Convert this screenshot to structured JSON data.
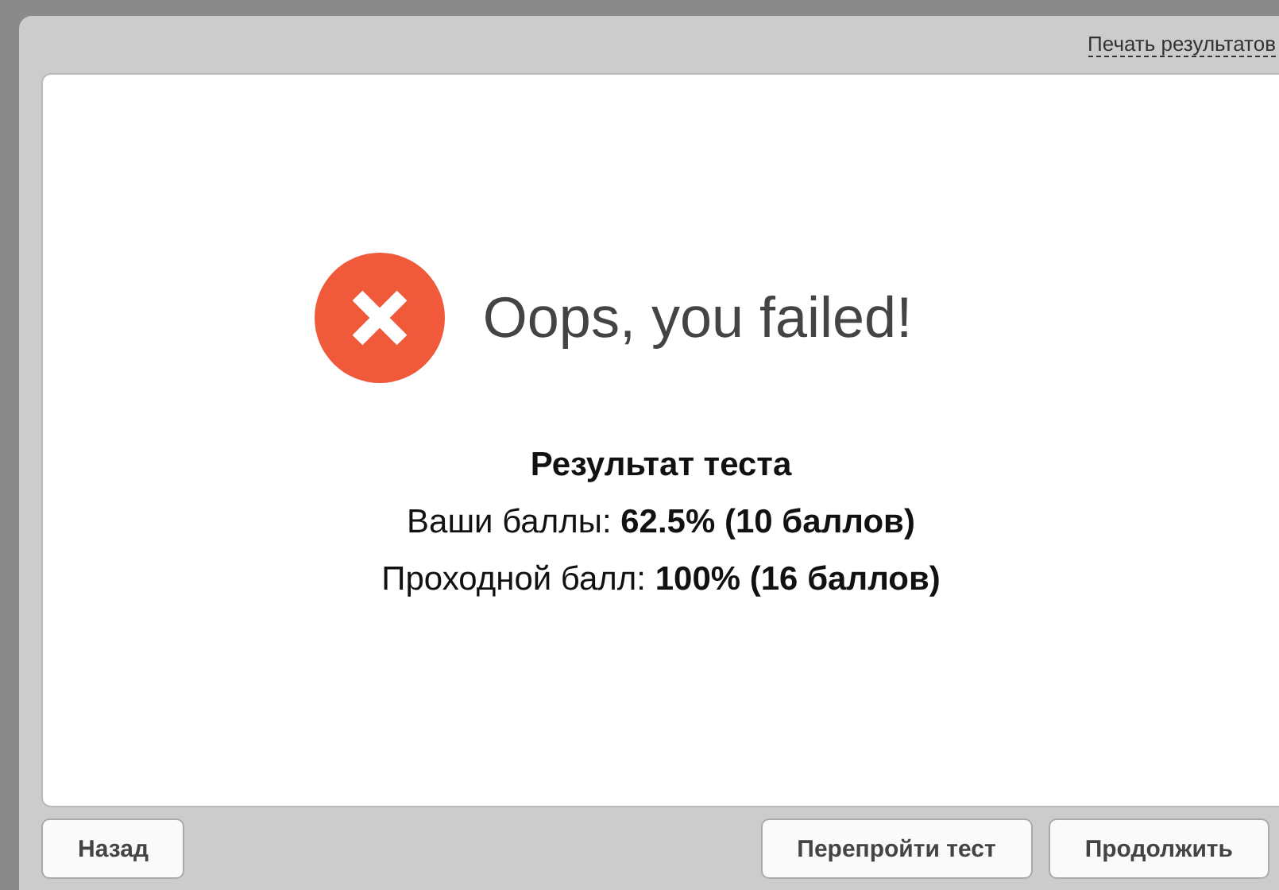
{
  "print_link": "Печать результатов",
  "result": {
    "kind": "error",
    "message": "Oops, you failed!",
    "heading": "Результат теста",
    "lines": [
      "Ваши баллы: **62.5% (10 баллов)**",
      "Проходной балл: **100% (16 баллов)**"
    ]
  },
  "buttons": {
    "left": [
      "Назад"
    ],
    "right": [
      "Перепройти тест",
      "Продолжить"
    ]
  }
}
